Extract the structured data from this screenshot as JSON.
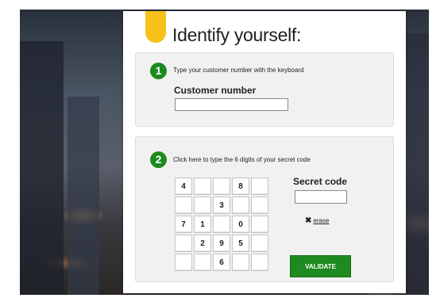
{
  "title": "Identify yourself:",
  "step1": {
    "number": "1",
    "instruction": "Type your customer number with the keyboard",
    "label": "Customer number",
    "value": ""
  },
  "step2": {
    "number": "2",
    "instruction": "Click here to type the 6 digits of your secret code",
    "label": "Secret code",
    "value": "",
    "erase_label": "erase",
    "validate_label": "VALIDATE"
  },
  "keypad": [
    [
      "4",
      "",
      "",
      "8",
      ""
    ],
    [
      "",
      "",
      "3",
      "",
      ""
    ],
    [
      "7",
      "1",
      "",
      "0",
      ""
    ],
    [
      "",
      "2",
      "9",
      "5",
      ""
    ],
    [
      "",
      "",
      "6",
      "",
      ""
    ]
  ],
  "colors": {
    "accent_green": "#1e8a1e",
    "flag_yellow": "#f6c21a"
  },
  "icons": {
    "erase": "close-x-icon"
  }
}
